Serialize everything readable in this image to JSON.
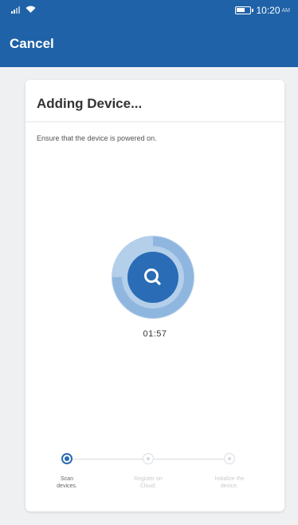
{
  "status_bar": {
    "time": "10:20",
    "ampm": "AM",
    "icons": [
      "signal-icon",
      "wifi-icon",
      "battery-icon"
    ]
  },
  "app_bar": {
    "cancel_label": "Cancel"
  },
  "card": {
    "title": "Adding Device...",
    "instruction": "Ensure that the device is powered on.",
    "timer": "01:57"
  },
  "steps": [
    {
      "label": "Scan\ndevices.",
      "state": "active"
    },
    {
      "label": "Register on\nCloud.",
      "state": "inactive"
    },
    {
      "label": "Initialize the\ndevice.",
      "state": "inactive"
    }
  ],
  "colors": {
    "header": "#1f62a8",
    "accent": "#2a6cb5",
    "scanner_ring": "#b4cfea",
    "background": "#eef0f2"
  }
}
